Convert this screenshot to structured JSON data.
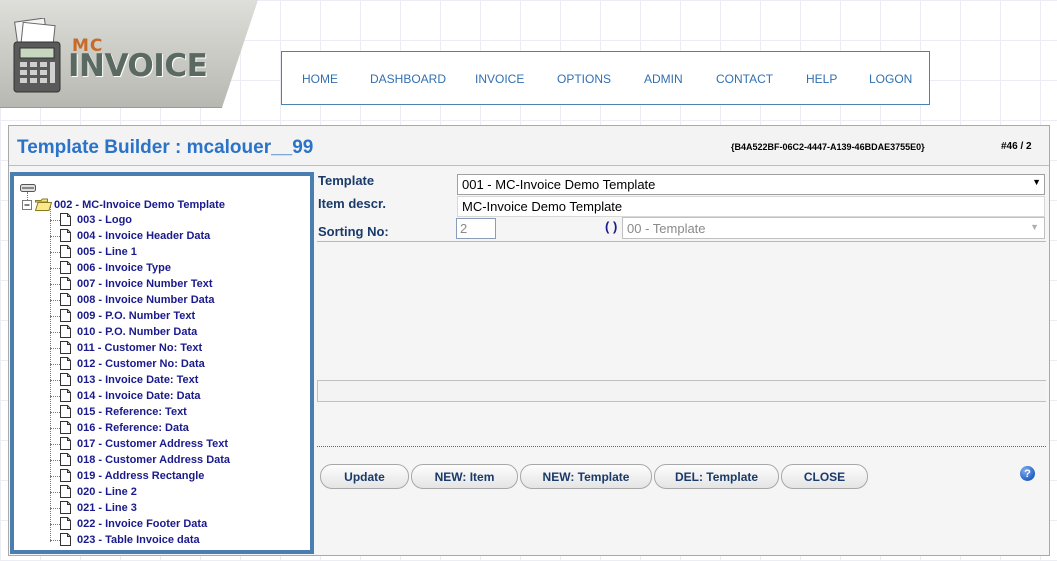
{
  "logo": {
    "mc": "MC",
    "invoice": "INVOICE"
  },
  "nav": [
    {
      "label": "HOME"
    },
    {
      "label": "DASHBOARD"
    },
    {
      "label": "INVOICE"
    },
    {
      "label": "OPTIONS"
    },
    {
      "label": "ADMIN"
    },
    {
      "label": "CONTACT"
    },
    {
      "label": "HELP"
    },
    {
      "label": "LOGON"
    }
  ],
  "page": {
    "title": "Template Builder : mcalouer__99",
    "guid": "{B4A522BF-06C2-4447-A139-46BDAE3755E0}",
    "record": "#46 / 2"
  },
  "tree": {
    "root": "002 - MC-Invoice Demo Template",
    "items": [
      "003 - Logo",
      "004 - Invoice Header Data",
      "005 - Line 1",
      "006 - Invoice Type",
      "007 - Invoice Number Text",
      "008 - Invoice Number Data",
      "009 - P.O. Number Text",
      "010 - P.O. Number Data",
      "011 - Customer No: Text",
      "012 - Customer No: Data",
      "013 - Invoice Date: Text",
      "014 - Invoice Date: Data",
      "015 - Reference: Text",
      "016 - Reference: Data",
      "017 - Customer Address Text",
      "018 - Customer Address Data",
      "019 - Address Rectangle",
      "020 - Line 2",
      "021 - Line 3",
      "022 - Invoice Footer Data",
      "023 - Table Invoice data"
    ]
  },
  "form": {
    "template_label": "Template",
    "template_value": "001 - MC-Invoice Demo Template",
    "item_descr_label": "Item descr.",
    "item_descr_value": "MC-Invoice Demo Template",
    "sorting_label": "Sorting No:",
    "sorting_value": "2",
    "parens": "( )",
    "parent_value": "00 - Template"
  },
  "buttons": {
    "update": "Update",
    "new_item": "NEW: Item",
    "new_template": "NEW: Template",
    "del_template": "DEL: Template",
    "close": "CLOSE",
    "help": "?"
  }
}
